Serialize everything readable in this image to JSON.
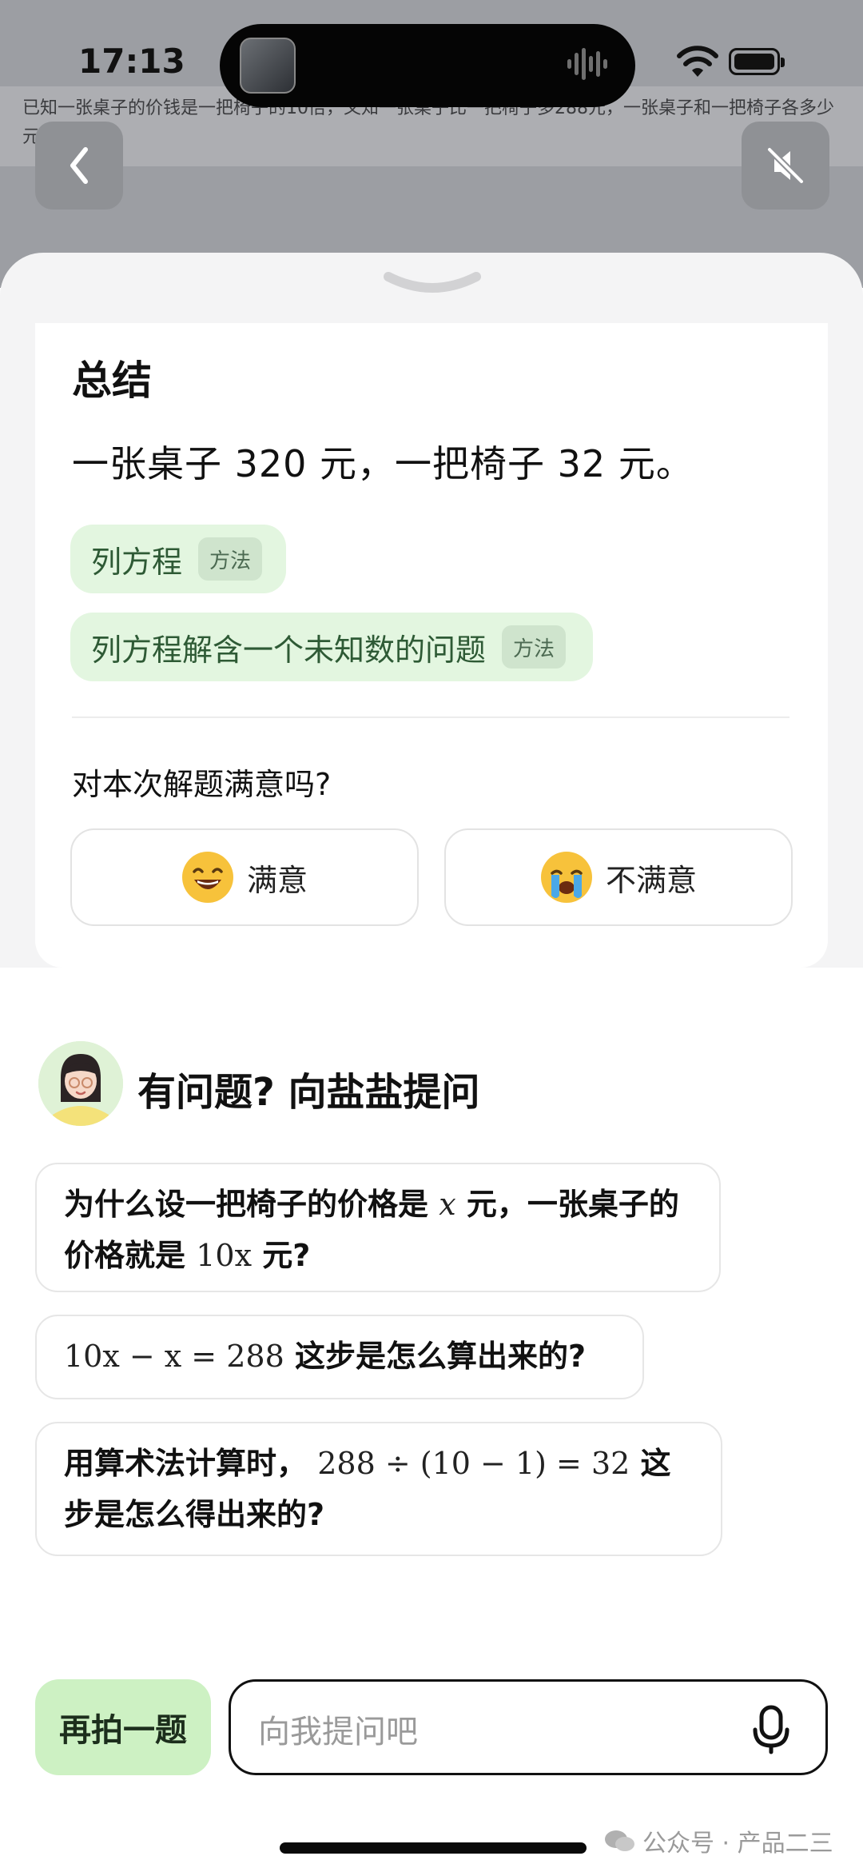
{
  "status_bar": {
    "time": "17:13"
  },
  "question": {
    "text": "已知一张桌子的价钱是一把椅子的10倍，又知一张桌子比一把椅子多288元，一张桌子和一把椅子各多少元?"
  },
  "summary": {
    "title": "总结",
    "answer": "一张桌子 320 元，一把椅子 32 元。",
    "tags": [
      {
        "label": "列方程",
        "kind": "方法"
      },
      {
        "label": "列方程解含一个未知数的问题",
        "kind": "方法"
      }
    ]
  },
  "feedback": {
    "question": "对本次解题满意吗?",
    "satisfied_label": "满意",
    "unsatisfied_label": "不满意"
  },
  "ask": {
    "title": "有问题? 向盐盐提问",
    "suggestions": [
      {
        "pre": "为什么设一把椅子的价格是 ",
        "m1": "x",
        "mid": " 元，一张桌子的价格就是 ",
        "m2": "10x",
        "post": " 元?"
      },
      {
        "math": "10x − x = 288",
        "post": " 这步是怎么算出来的?"
      },
      {
        "pre": "用算术法计算时， ",
        "math": "288 ÷ (10 − 1) = 32",
        "post": " 这步是怎么得出来的?"
      }
    ]
  },
  "bottom_bar": {
    "retake_label": "再拍一题",
    "input_placeholder": "向我提问吧"
  },
  "watermark": "公众号 · 产品二三",
  "colors": {
    "tag_bg": "#e3f6e0",
    "retake_bg": "#cdf1c3",
    "dim_bg": "#9c9ea3"
  }
}
